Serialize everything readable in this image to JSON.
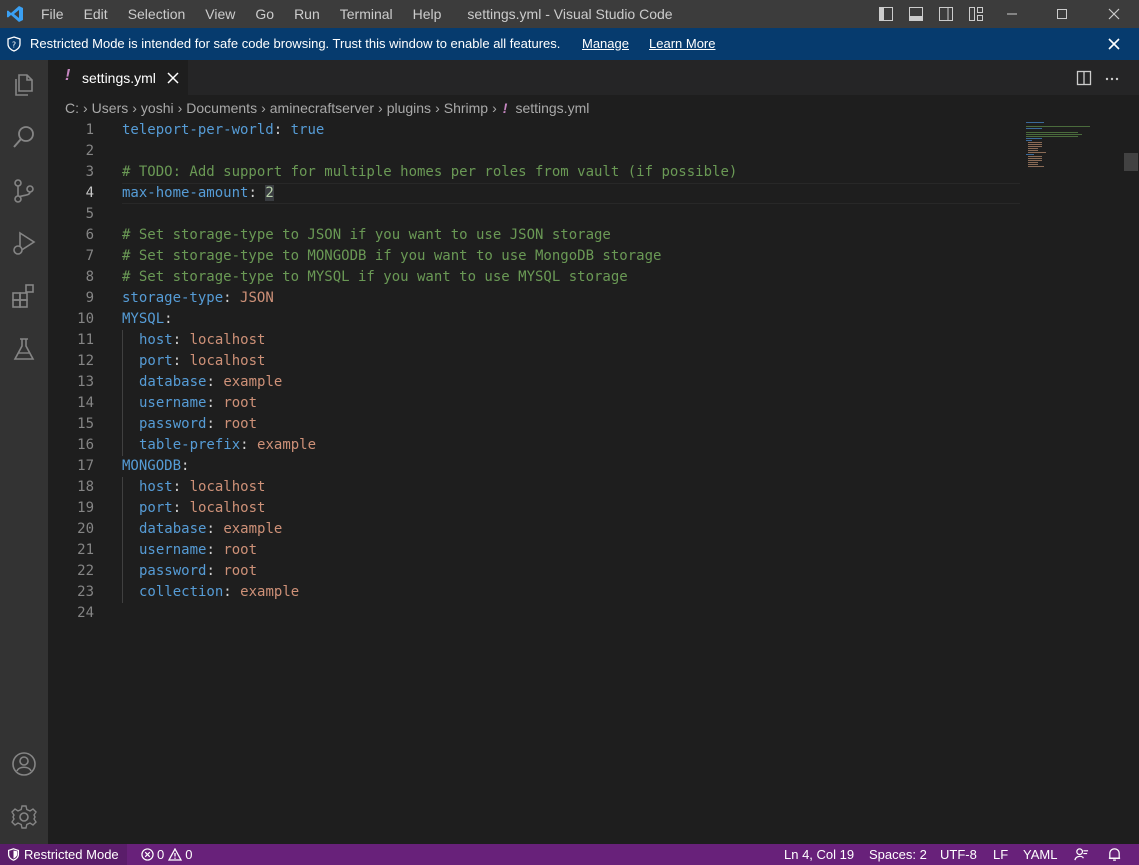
{
  "menu": [
    "File",
    "Edit",
    "Selection",
    "View",
    "Go",
    "Run",
    "Terminal",
    "Help"
  ],
  "window_title": "settings.yml - Visual Studio Code",
  "banner": {
    "message": "Restricted Mode is intended for safe code browsing. Trust this window to enable all features.",
    "manage": "Manage",
    "learn_more": "Learn More"
  },
  "tab": {
    "label": "settings.yml",
    "icon": "!"
  },
  "breadcrumb": [
    "C:",
    "Users",
    "yoshi",
    "Documents",
    "aminecraftserver",
    "plugins",
    "Shrimp",
    "settings.yml"
  ],
  "breadcrumb_file_icon": "!",
  "editor": {
    "line_numbers": [
      "1",
      "2",
      "3",
      "4",
      "5",
      "6",
      "7",
      "8",
      "9",
      "10",
      "11",
      "12",
      "13",
      "14",
      "15",
      "16",
      "17",
      "18",
      "19",
      "20",
      "21",
      "22",
      "23",
      "24"
    ],
    "active_line": "4",
    "tokens": {
      "l1_key": "teleport-per-world",
      "l1_val": "true",
      "l3_comment": "# TODO: Add support for multiple homes per roles from vault (if possible)",
      "l4_key": "max-home-amount",
      "l4_val": "2",
      "l6_comment": "# Set storage-type to JSON if you want to use JSON storage",
      "l7_comment": "# Set storage-type to MONGODB if you want to use MongoDB storage",
      "l8_comment": "# Set storage-type to MYSQL if you want to use MYSQL storage",
      "l9_key": "storage-type",
      "l9_val": "JSON",
      "l10_key": "MYSQL",
      "l11_key": "host",
      "l11_val": "localhost",
      "l12_key": "port",
      "l12_val": "localhost",
      "l13_key": "database",
      "l13_val": "example",
      "l14_key": "username",
      "l14_val": "root",
      "l15_key": "password",
      "l15_val": "root",
      "l16_key": "table-prefix",
      "l16_val": "example",
      "l17_key": "MONGODB",
      "l18_key": "host",
      "l18_val": "localhost",
      "l19_key": "port",
      "l19_val": "localhost",
      "l20_key": "database",
      "l20_val": "example",
      "l21_key": "username",
      "l21_val": "root",
      "l22_key": "password",
      "l22_val": "root",
      "l23_key": "collection",
      "l23_val": "example",
      "colon": ":"
    }
  },
  "status": {
    "restricted": "Restricted Mode",
    "errors": "0",
    "warnings": "0",
    "position": "Ln 4, Col 19",
    "spaces": "Spaces: 2",
    "encoding": "UTF-8",
    "eol": "LF",
    "language": "YAML"
  },
  "colors": {
    "status_bar": "#68217a",
    "banner": "#063b6e",
    "activity_bar": "#333333",
    "editor_bg": "#1e1e1e"
  },
  "icons": [
    "vscode-logo-icon",
    "explorer-icon",
    "search-icon",
    "source-control-icon",
    "run-debug-icon",
    "extensions-icon",
    "testing-icon",
    "accounts-icon",
    "manage-gear-icon",
    "split-editor-icon",
    "more-actions-icon",
    "close-icon",
    "shield-icon",
    "error-icon",
    "warning-icon",
    "feedback-icon",
    "bell-icon"
  ]
}
